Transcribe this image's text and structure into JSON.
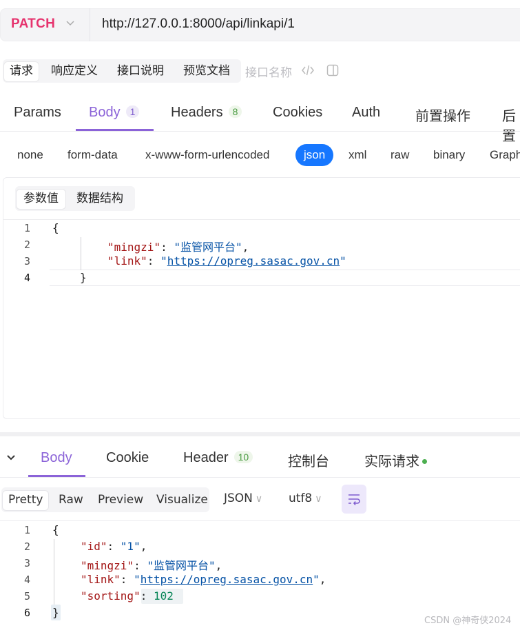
{
  "request": {
    "method": "PATCH",
    "url": "http://127.0.0.1:8000/api/linkapi/1"
  },
  "subtabs": [
    "请求",
    "响应定义",
    "接口说明",
    "预览文档"
  ],
  "interface_name_placeholder": "接口名称",
  "main_tabs": [
    {
      "label": "Params",
      "badge": ""
    },
    {
      "label": "Body",
      "badge": "1"
    },
    {
      "label": "Headers",
      "badge": "8"
    },
    {
      "label": "Cookies",
      "badge": ""
    },
    {
      "label": "Auth",
      "badge": ""
    },
    {
      "label": "前置操作",
      "badge": ""
    },
    {
      "label": "后置",
      "badge": ""
    }
  ],
  "body_types": [
    "none",
    "form-data",
    "x-www-form-urlencoded",
    "json",
    "xml",
    "raw",
    "binary",
    "GraphQL"
  ],
  "body_segment": [
    "参数值",
    "数据结构"
  ],
  "request_body": {
    "line_numbers": [
      "1",
      "2",
      "3",
      "4"
    ],
    "open": "{",
    "key1": "\"mingzi\"",
    "val1": "\"监管网平台\"",
    "key2": "\"link\"",
    "val2_q1": "\"",
    "val2_url": "https://opreg.sasac.gov.cn",
    "val2_q2": "\"",
    "close": "}"
  },
  "response_tabs": [
    {
      "label": "Body",
      "badge": ""
    },
    {
      "label": "Cookie",
      "badge": ""
    },
    {
      "label": "Header",
      "badge": "10"
    },
    {
      "label": "控制台",
      "badge": ""
    },
    {
      "label": "实际请求",
      "badge": ""
    }
  ],
  "view_modes": [
    "Pretty",
    "Raw",
    "Preview",
    "Visualize"
  ],
  "format_select": "JSON",
  "encoding_select": "utf8",
  "response_body": {
    "line_numbers": [
      "1",
      "2",
      "3",
      "4",
      "5",
      "6"
    ],
    "open": "{",
    "k_id": "\"id\"",
    "v_id": "\"1\"",
    "k_mingzi": "\"mingzi\"",
    "v_mingzi": "\"监管网平台\"",
    "k_link": "\"link\"",
    "v_link_q1": "\"",
    "v_link_url": "https://opreg.sasac.gov.cn",
    "v_link_q2": "\"",
    "k_sorting": "\"sorting\"",
    "v_sorting": "102",
    "close": "}"
  },
  "watermark": "CSDN @神奇侠2024",
  "colors": {
    "method": "#e6336e",
    "accent": "#8b63d8",
    "json_active": "#1677ff"
  }
}
